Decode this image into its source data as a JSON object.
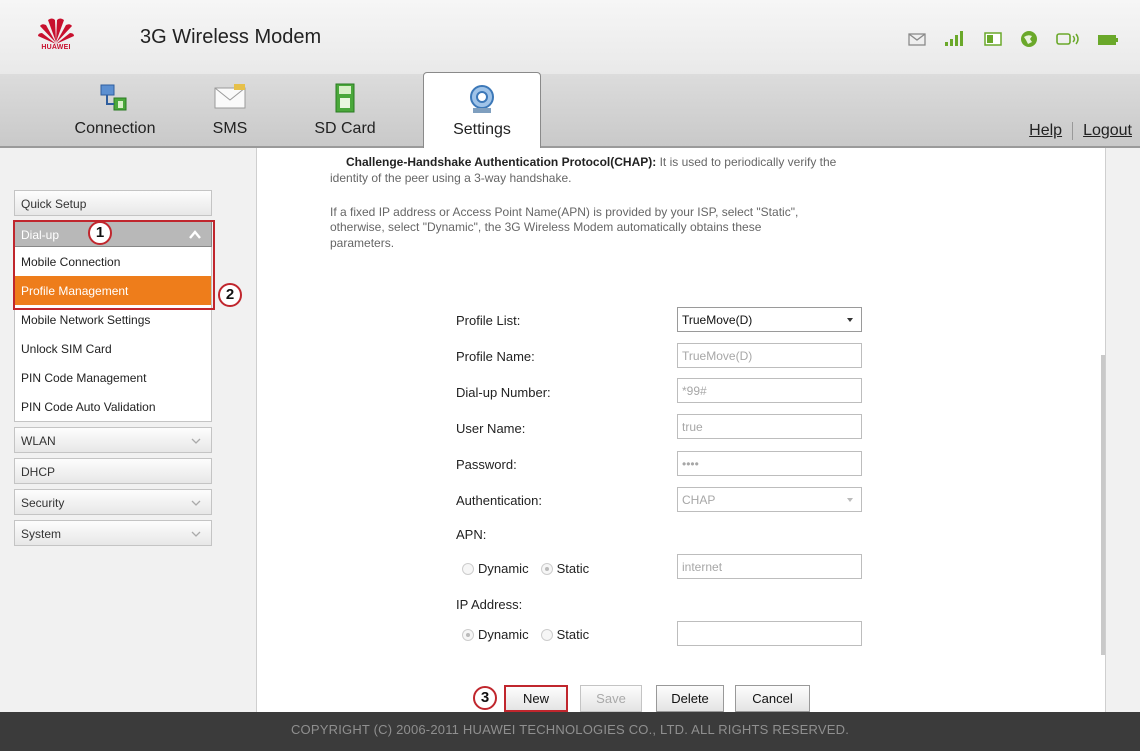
{
  "header": {
    "logo_text": "HUAWEI",
    "app_title": "3G Wireless Modem",
    "status_icons": [
      "mail-icon",
      "signal-icon",
      "sim-icon",
      "globe-icon",
      "wifi-icon",
      "battery-icon"
    ]
  },
  "tabs": [
    {
      "label": "Connection",
      "icon": "connection-icon"
    },
    {
      "label": "SMS",
      "icon": "sms-icon"
    },
    {
      "label": "SD Card",
      "icon": "sd-card-icon"
    },
    {
      "label": "Settings",
      "icon": "settings-icon",
      "active": true
    }
  ],
  "toplinks": {
    "help": "Help",
    "logout": "Logout"
  },
  "sidebar": {
    "quick_setup": "Quick Setup",
    "dialup": "Dial-up",
    "dialup_items": [
      "Mobile Connection",
      "Profile Management",
      "Mobile Network Settings",
      "Unlock SIM Card",
      "PIN Code Management",
      "PIN Code Auto Validation"
    ],
    "active_item": "Profile Management",
    "wlan": "WLAN",
    "dhcp": "DHCP",
    "security": "Security",
    "system": "System"
  },
  "annotations": {
    "step1": "1",
    "step2": "2",
    "step3": "3"
  },
  "description": {
    "chap_title": "Challenge-Handshake Authentication Protocol(CHAP):",
    "chap_text": " It is used to periodically verify the",
    "chap_text2": "identity of the peer using a 3-way handshake.",
    "static_line1": "If a fixed IP address or Access Point Name(APN) is provided by your ISP, select \"Static\",",
    "static_line2": "otherwise, select \"Dynamic\", the 3G Wireless Modem automatically obtains these",
    "static_line3": "parameters."
  },
  "form": {
    "profile_list_label": "Profile List:",
    "profile_list_value": "TrueMove(D)",
    "profile_name_label": "Profile Name:",
    "profile_name_value": "TrueMove(D)",
    "dialup_number_label": "Dial-up Number:",
    "dialup_number_value": "*99#",
    "username_label": "User Name:",
    "username_value": "true",
    "password_label": "Password:",
    "password_value": "••••",
    "auth_label": "Authentication:",
    "auth_value": "CHAP",
    "apn_label": "APN:",
    "apn_dynamic": "Dynamic",
    "apn_static": "Static",
    "apn_selected": "Static",
    "apn_value": "internet",
    "ip_label": "IP Address:",
    "ip_dynamic": "Dynamic",
    "ip_static": "Static",
    "ip_selected": "Dynamic",
    "ip_value": ""
  },
  "buttons": {
    "new": "New",
    "save": "Save",
    "delete": "Delete",
    "cancel": "Cancel"
  },
  "footer": "COPYRIGHT (C) 2006-2011 HUAWEI TECHNOLOGIES CO., LTD. ALL RIGHTS RESERVED.",
  "colors": {
    "accent_orange": "#ee7d1b",
    "annotation_red": "#c0262d",
    "footer_bg": "#3b3b3b"
  }
}
